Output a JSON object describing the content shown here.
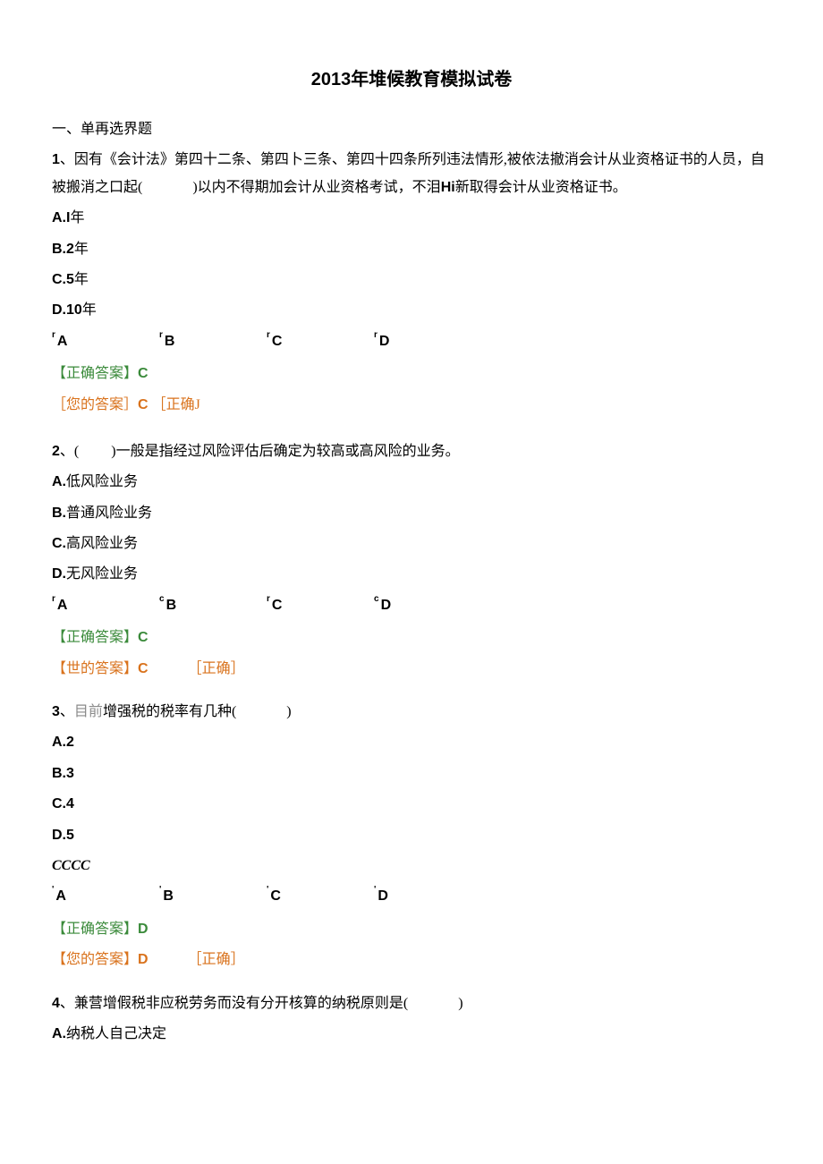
{
  "title_year": "2013",
  "title_rest": "年堆候教育模拟试卷",
  "section_heading": "一、单再选界题",
  "q1": {
    "num": "1",
    "text_a": "、因有《会计法》第四十二条、第四卜三条、第四十四条所列违法情形,被依法撤消会计从业资格证书的人员，自被搬消之口起(",
    "text_b": ")以内不得期加会计从业资格考试，不泪",
    "hi": "Hi",
    "text_c": "新取得会计从业资格证书。",
    "optA": {
      "lbl": "A.I",
      "txt": "年"
    },
    "optB": {
      "lbl": "B.2",
      "txt": "年"
    },
    "optC": {
      "lbl": "C.5",
      "txt": "年"
    },
    "optD": {
      "lbl": "D.10",
      "txt": "年"
    },
    "row": {
      "supA": "r",
      "A": "A",
      "supB": "r",
      "B": "B",
      "supC": "r",
      "C": "C",
      "supD": "r",
      "D": "D"
    },
    "correct_label": "【正确答案】",
    "correct_val": "C",
    "your_label": "［您的答案］",
    "your_val": "C",
    "your_mark": "［正确J"
  },
  "q2": {
    "num": "2",
    "text_a": "、(",
    "text_b": ")一般是指经过风险评估后确定为较高或高风险的业务。",
    "optA": {
      "lbl": "A.",
      "txt": "低风险业务"
    },
    "optB": {
      "lbl": "B.",
      "txt": "普通风险业务"
    },
    "optC": {
      "lbl": "C.",
      "txt": "高风险业务"
    },
    "optD": {
      "lbl": "D.",
      "txt": "无风险业务"
    },
    "row": {
      "supA": "r",
      "A": "A",
      "supB": "c",
      "B": "B",
      "supC": "r",
      "C": "C",
      "supD": "c",
      "D": "D"
    },
    "correct_label": "【正确答案】",
    "correct_val": "C",
    "your_label": "【世的答案】",
    "your_val": "C",
    "your_mark": "［正确］"
  },
  "q3": {
    "num": "3",
    "text_grey": "目前",
    "text_a": "增强税的税率有几种(",
    "text_b": ")",
    "optA": {
      "lbl": "A.2"
    },
    "optB": {
      "lbl": "B.3"
    },
    "optC": {
      "lbl": "C.4"
    },
    "optD": {
      "lbl": "D.5"
    },
    "cccc": "CCCC",
    "row": {
      "supA": "'",
      "A": "A",
      "supB": "'",
      "B": "B",
      "supC": "'",
      "C": "C",
      "supD": "'",
      "D": "D"
    },
    "correct_label": "【正确答案】",
    "correct_val": "D",
    "your_label": "【您的答案】",
    "your_val": "D",
    "your_mark": "［正确］"
  },
  "q4": {
    "num": "4",
    "text_a": "、兼营增假税非应税劳务而没有分开核算的纳税原则是(",
    "text_b": ")",
    "optA": {
      "lbl": "A.",
      "txt": "纳税人自己决定"
    }
  }
}
